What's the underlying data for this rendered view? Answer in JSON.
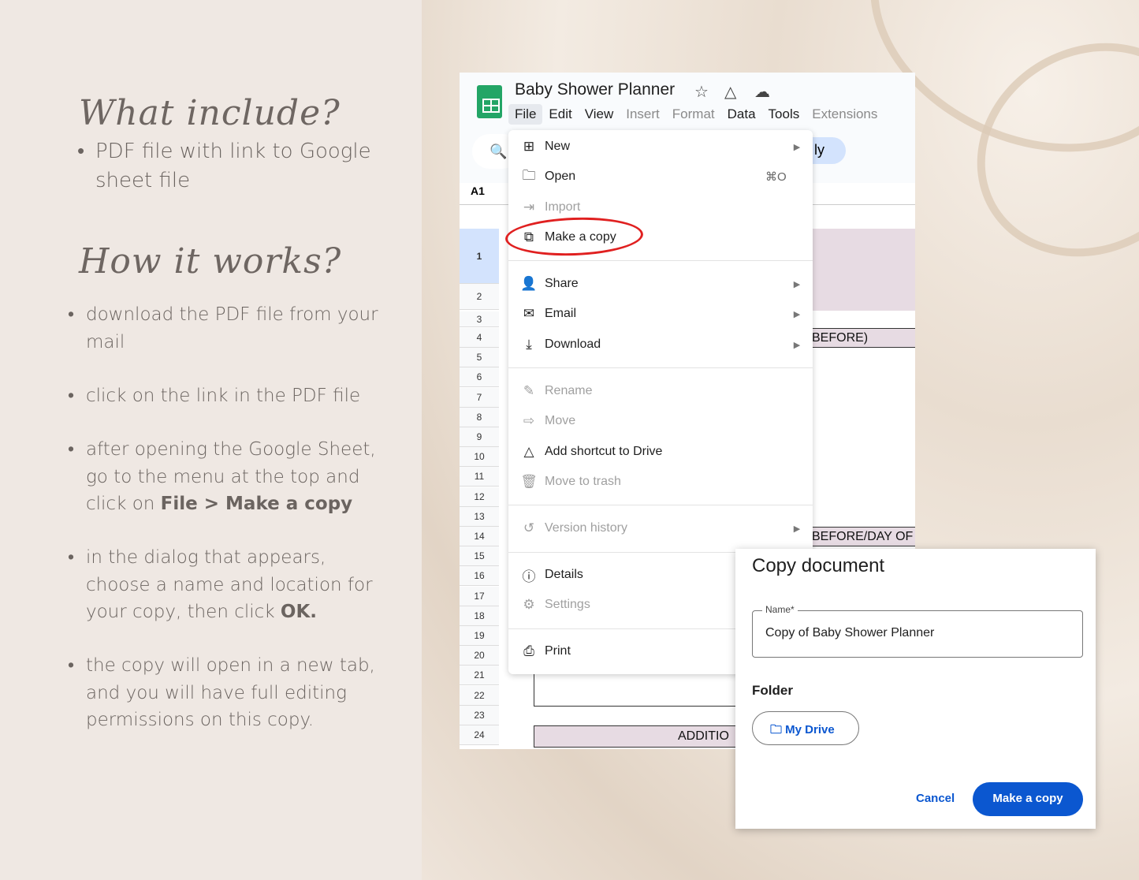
{
  "left": {
    "heading1": "What include?",
    "include_items": [
      "PDF file with link to Google sheet file"
    ],
    "heading2": "How it works?",
    "steps": [
      {
        "text": "download the PDF file from your mail"
      },
      {
        "text": "click on the link in the PDF file"
      },
      {
        "pre": "after opening the Google Sheet, go to the menu at the top and click on ",
        "bold": "File > Make a copy"
      },
      {
        "pre": "in the dialog that appears, choose a name and location for your copy, then click ",
        "bold": "OK."
      },
      {
        "text": "the copy will open in a new tab, and you will have full editing permissions on this copy."
      }
    ]
  },
  "sheet": {
    "title": "Baby Shower Planner",
    "title_icons": [
      "star-icon",
      "drive-add-icon",
      "cloud-saved-icon"
    ],
    "menus": [
      {
        "label": "File",
        "active": true
      },
      {
        "label": "Edit"
      },
      {
        "label": "View"
      },
      {
        "label": "Insert",
        "dim": true
      },
      {
        "label": "Format",
        "dim": true
      },
      {
        "label": "Data"
      },
      {
        "label": "Tools"
      },
      {
        "label": "Extensions",
        "dim": true
      }
    ],
    "pill_text": "ly",
    "cell_ref": "A1",
    "rows": [
      "1",
      "2",
      "3",
      "4",
      "5",
      "6",
      "7",
      "8",
      "9",
      "10",
      "11",
      "12",
      "13",
      "14",
      "15",
      "16",
      "17",
      "18",
      "19",
      "20",
      "21",
      "22",
      "23",
      "24"
    ],
    "cells": {
      "r4": "BEFORE)",
      "r14": "BEFORE/DAY OF",
      "r24": "ADDITIO"
    },
    "header_color": "#e7dbe3"
  },
  "file_menu": {
    "items": [
      {
        "label": "New",
        "icon": "new-sheet-icon",
        "glyph": "⊞",
        "arrow": true
      },
      {
        "label": "Open",
        "icon": "folder-icon",
        "glyph": "🗀",
        "shortcut": "⌘O"
      },
      {
        "label": "Import",
        "icon": "import-icon",
        "glyph": "⇥",
        "disabled": true
      },
      {
        "label": "Make a copy",
        "icon": "copy-icon",
        "glyph": "⧉",
        "highlighted": true
      },
      {
        "label": "Share",
        "icon": "share-person-icon",
        "glyph": "👤",
        "arrow": true
      },
      {
        "label": "Email",
        "icon": "email-icon",
        "glyph": "✉",
        "arrow": true
      },
      {
        "label": "Download",
        "icon": "download-icon",
        "glyph": "⤓",
        "arrow": true
      },
      {
        "label": "Rename",
        "icon": "rename-icon",
        "glyph": "✎",
        "disabled": true
      },
      {
        "label": "Move",
        "icon": "move-icon",
        "glyph": "⇨",
        "disabled": true
      },
      {
        "label": "Add shortcut to Drive",
        "icon": "drive-add-icon",
        "glyph": "△"
      },
      {
        "label": "Move to trash",
        "icon": "trash-icon",
        "glyph": "🗑",
        "disabled": true
      },
      {
        "label": "Version history",
        "icon": "history-icon",
        "glyph": "↺",
        "disabled": true,
        "arrow": true
      },
      {
        "label": "Details",
        "icon": "info-icon",
        "glyph": "ⓘ"
      },
      {
        "label": "Settings",
        "icon": "gear-icon",
        "glyph": "⚙",
        "disabled": true
      },
      {
        "label": "Print",
        "icon": "print-icon",
        "glyph": "⎙"
      }
    ],
    "highlight_color": "#e02020"
  },
  "dialog": {
    "title": "Copy document",
    "name_label": "Name*",
    "name_value": "Copy of Baby Shower Planner",
    "folder_label": "Folder",
    "folder_button": "My Drive",
    "cancel": "Cancel",
    "confirm": "Make a copy",
    "accent": "#0b57d0"
  }
}
